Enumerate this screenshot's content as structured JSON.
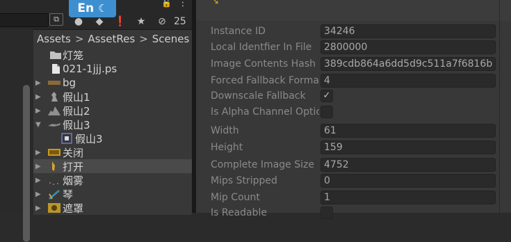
{
  "toolbar": {
    "language_badge": "En",
    "moon_glyph": "☾",
    "hidden_count": "25",
    "icons": [
      "circle-icon",
      "tag-icon",
      "warning-icon",
      "star-icon",
      "eye-slash-icon"
    ]
  },
  "breadcrumb": {
    "items": [
      "Assets",
      "AssetRes",
      "Scenes"
    ],
    "separator": ">"
  },
  "tree": {
    "items": [
      {
        "label": "灯笼",
        "icon": "folder-icon",
        "arrow": ""
      },
      {
        "label": "021-1jjj.ps",
        "icon": "file-icon",
        "arrow": ""
      },
      {
        "label": "bg",
        "icon": "sprite-icon",
        "arrow": "▶"
      },
      {
        "label": "假山1",
        "icon": "sprite-icon",
        "arrow": "▶"
      },
      {
        "label": "假山2",
        "icon": "sprite-icon",
        "arrow": "▶"
      },
      {
        "label": "假山3",
        "icon": "sprite-icon",
        "arrow": "▼"
      },
      {
        "label": "假山3",
        "icon": "sub-sprite-icon",
        "arrow": ""
      },
      {
        "label": "关闭",
        "icon": "sprite-icon",
        "arrow": "▶"
      },
      {
        "label": "打开",
        "icon": "sprite-icon",
        "arrow": "▶"
      },
      {
        "label": "烟雾",
        "icon": "sprite-icon",
        "arrow": "▶"
      },
      {
        "label": "琴",
        "icon": "sprite-icon",
        "arrow": "▶"
      },
      {
        "label": "遮罩",
        "icon": "sprite-icon",
        "arrow": "▶"
      }
    ]
  },
  "inspector": {
    "fields": [
      {
        "label": "Instance ID",
        "value": "34246"
      },
      {
        "label": "Local Identfier In File",
        "value": "2800000"
      },
      {
        "label": "Image Contents Hash",
        "value": "389cdb864a6dd5d9c511a7f6816b"
      },
      {
        "label": "Forced Fallback Forma",
        "value": "4"
      },
      {
        "label": "Downscale Fallback",
        "value": "✓"
      },
      {
        "label": "Is Alpha Channel Optic",
        "value": ""
      },
      {
        "label": "Width",
        "value": "61"
      },
      {
        "label": "Height",
        "value": "159"
      },
      {
        "label": "Complete Image Size",
        "value": "4752"
      },
      {
        "label": "Mips Stripped",
        "value": "0"
      },
      {
        "label": "Mip Count",
        "value": "1"
      },
      {
        "label": "Is Readable",
        "value": ""
      }
    ]
  }
}
